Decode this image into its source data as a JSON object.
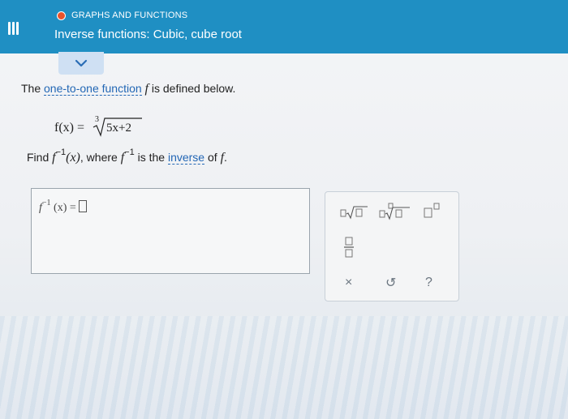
{
  "header": {
    "section": "GRAPHS AND FUNCTIONS",
    "title": "Inverse functions: Cubic, cube root",
    "status_color": "#e8532c",
    "bar_color": "#1f8fc3"
  },
  "problem": {
    "intro_prefix": "The ",
    "intro_link": "one-to-one function",
    "intro_f": "f",
    "intro_suffix": " is defined below.",
    "equation_lhs": "f(x) =",
    "root_index": "3",
    "radicand": "5x+2",
    "find_prefix": "Find ",
    "find_f": "f",
    "find_sup": "−1",
    "find_arg": "(x)",
    "find_mid": ", where ",
    "where_f": "f",
    "where_sup": "−1",
    "find_is": " is the ",
    "inverse_link": "inverse",
    "of_text": " of ",
    "of_f": "f",
    "end": "."
  },
  "answer": {
    "label_f": "f",
    "label_sup": "−1",
    "label_rest": "(x) ="
  },
  "tools": {
    "icons": [
      "nth-root-icon",
      "square-root-icon",
      "exponent-icon",
      "fraction-icon"
    ],
    "clear": "×",
    "undo": "↺",
    "help": "?"
  }
}
